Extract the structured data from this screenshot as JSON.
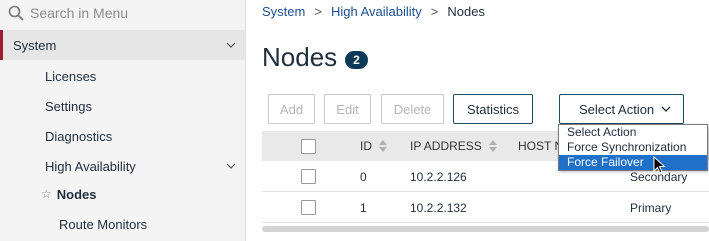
{
  "sidebar": {
    "search_placeholder": "Search in Menu",
    "system_label": "System",
    "items": [
      {
        "label": "Licenses"
      },
      {
        "label": "Settings"
      },
      {
        "label": "Diagnostics"
      },
      {
        "label": "High Availability"
      }
    ],
    "sub_items": [
      {
        "label": "Nodes",
        "selected": true
      },
      {
        "label": "Route Monitors"
      }
    ]
  },
  "breadcrumb": {
    "items": [
      "System",
      "High Availability",
      "Nodes"
    ],
    "separator": ">"
  },
  "page": {
    "title": "Nodes",
    "count": "2"
  },
  "toolbar": {
    "add": "Add",
    "edit": "Edit",
    "delete": "Delete",
    "statistics": "Statistics",
    "select_action": "Select Action"
  },
  "table": {
    "columns": [
      "ID",
      "IP ADDRESS",
      "HOST N"
    ],
    "rows": [
      {
        "id": "0",
        "ip": "10.2.2.126",
        "state": "Secondary"
      },
      {
        "id": "1",
        "ip": "10.2.2.132",
        "state": "Primary"
      }
    ]
  },
  "dropdown": {
    "options": [
      "Select Action",
      "Force Synchronization",
      "Force Failover"
    ],
    "highlighted": "Force Failover"
  },
  "colors": {
    "accent": "#9e1b32",
    "badge": "#0f3a57",
    "link": "#1d4f91",
    "highlight": "#1e70c8"
  }
}
